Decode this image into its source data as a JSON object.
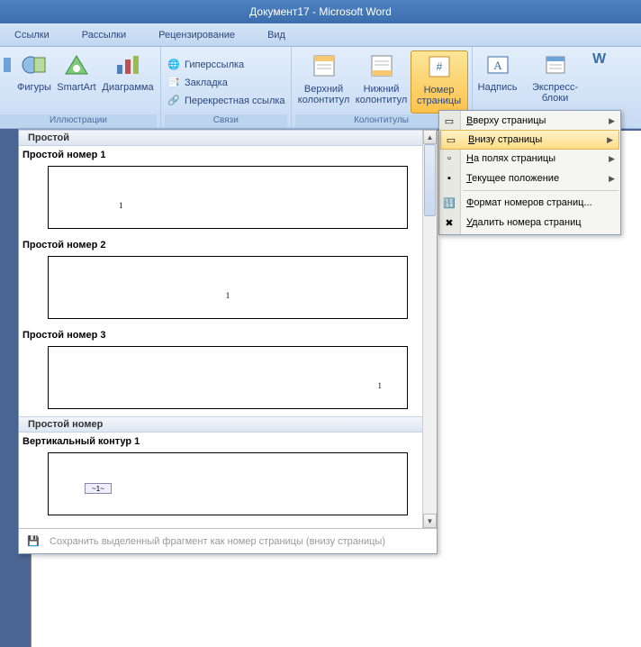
{
  "title": "Документ17 - Microsoft Word",
  "tabs": [
    "Ссылки",
    "Рассылки",
    "Рецензирование",
    "Вид"
  ],
  "ribbon": {
    "illustrations": {
      "shapes": "Фигуры",
      "smartart": "SmartArt",
      "chart": "Диаграмма",
      "group": "Иллюстрации"
    },
    "links": {
      "hyperlink": "Гиперссылка",
      "bookmark": "Закладка",
      "crossref": "Перекрестная ссылка",
      "group": "Связи"
    },
    "hf": {
      "header": "Верхний колонтитул",
      "footer": "Нижний колонтитул",
      "pagenum": "Номер страницы",
      "group": "Колонтитулы"
    },
    "text": {
      "textbox": "Надпись",
      "quickparts": "Экспресс-блоки",
      "wordart_initial": "W"
    }
  },
  "menu": {
    "top": "Вверху страницы",
    "bottom": "Внизу страницы",
    "margins": "На полях страницы",
    "current": "Текущее положение",
    "format": "Формат номеров страниц...",
    "remove": "Удалить номера страниц"
  },
  "gallery": {
    "cat_simple": "Простой",
    "simple1": "Простой номер 1",
    "simple2": "Простой номер 2",
    "simple3": "Простой номер 3",
    "cat_simplenum": "Простой номер",
    "vert1": "Вертикальный контур 1",
    "sample": "1",
    "footer_save": "Сохранить выделенный фрагмент как номер страницы (внизу страницы)"
  }
}
